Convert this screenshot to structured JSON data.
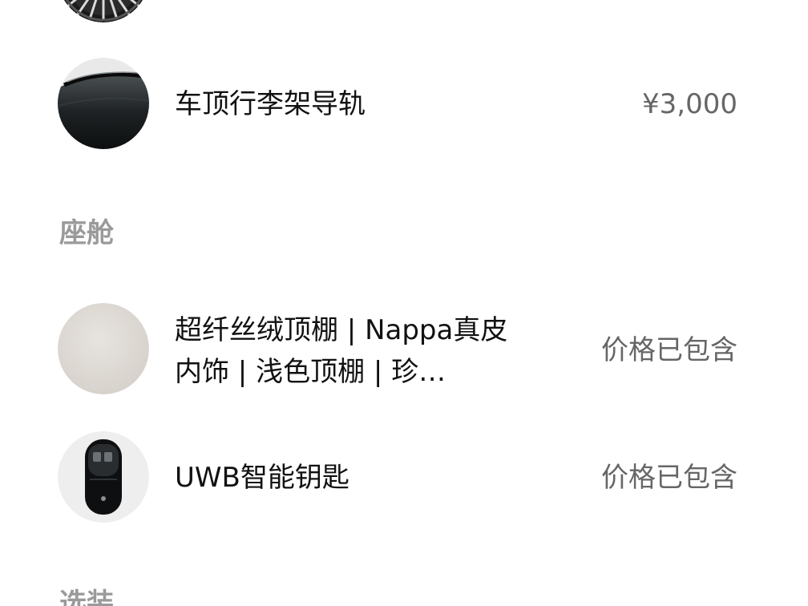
{
  "items": [
    {
      "name": "车顶行李架导轨",
      "price": "¥3,000",
      "icon": "roof-rail-icon"
    },
    {
      "name": "超纤丝绒顶棚 | Nappa真皮内饰 | 浅色顶棚 | 珍…",
      "price": "价格已包含",
      "icon": "headliner-swatch-icon"
    },
    {
      "name": "UWB智能钥匙",
      "price": "价格已包含",
      "icon": "car-key-icon"
    }
  ],
  "sections": {
    "cabin": "座舱",
    "options": "选装"
  },
  "colors": {
    "section_text": "#9a9a9a",
    "price_text": "#666666",
    "item_text": "#111111"
  }
}
